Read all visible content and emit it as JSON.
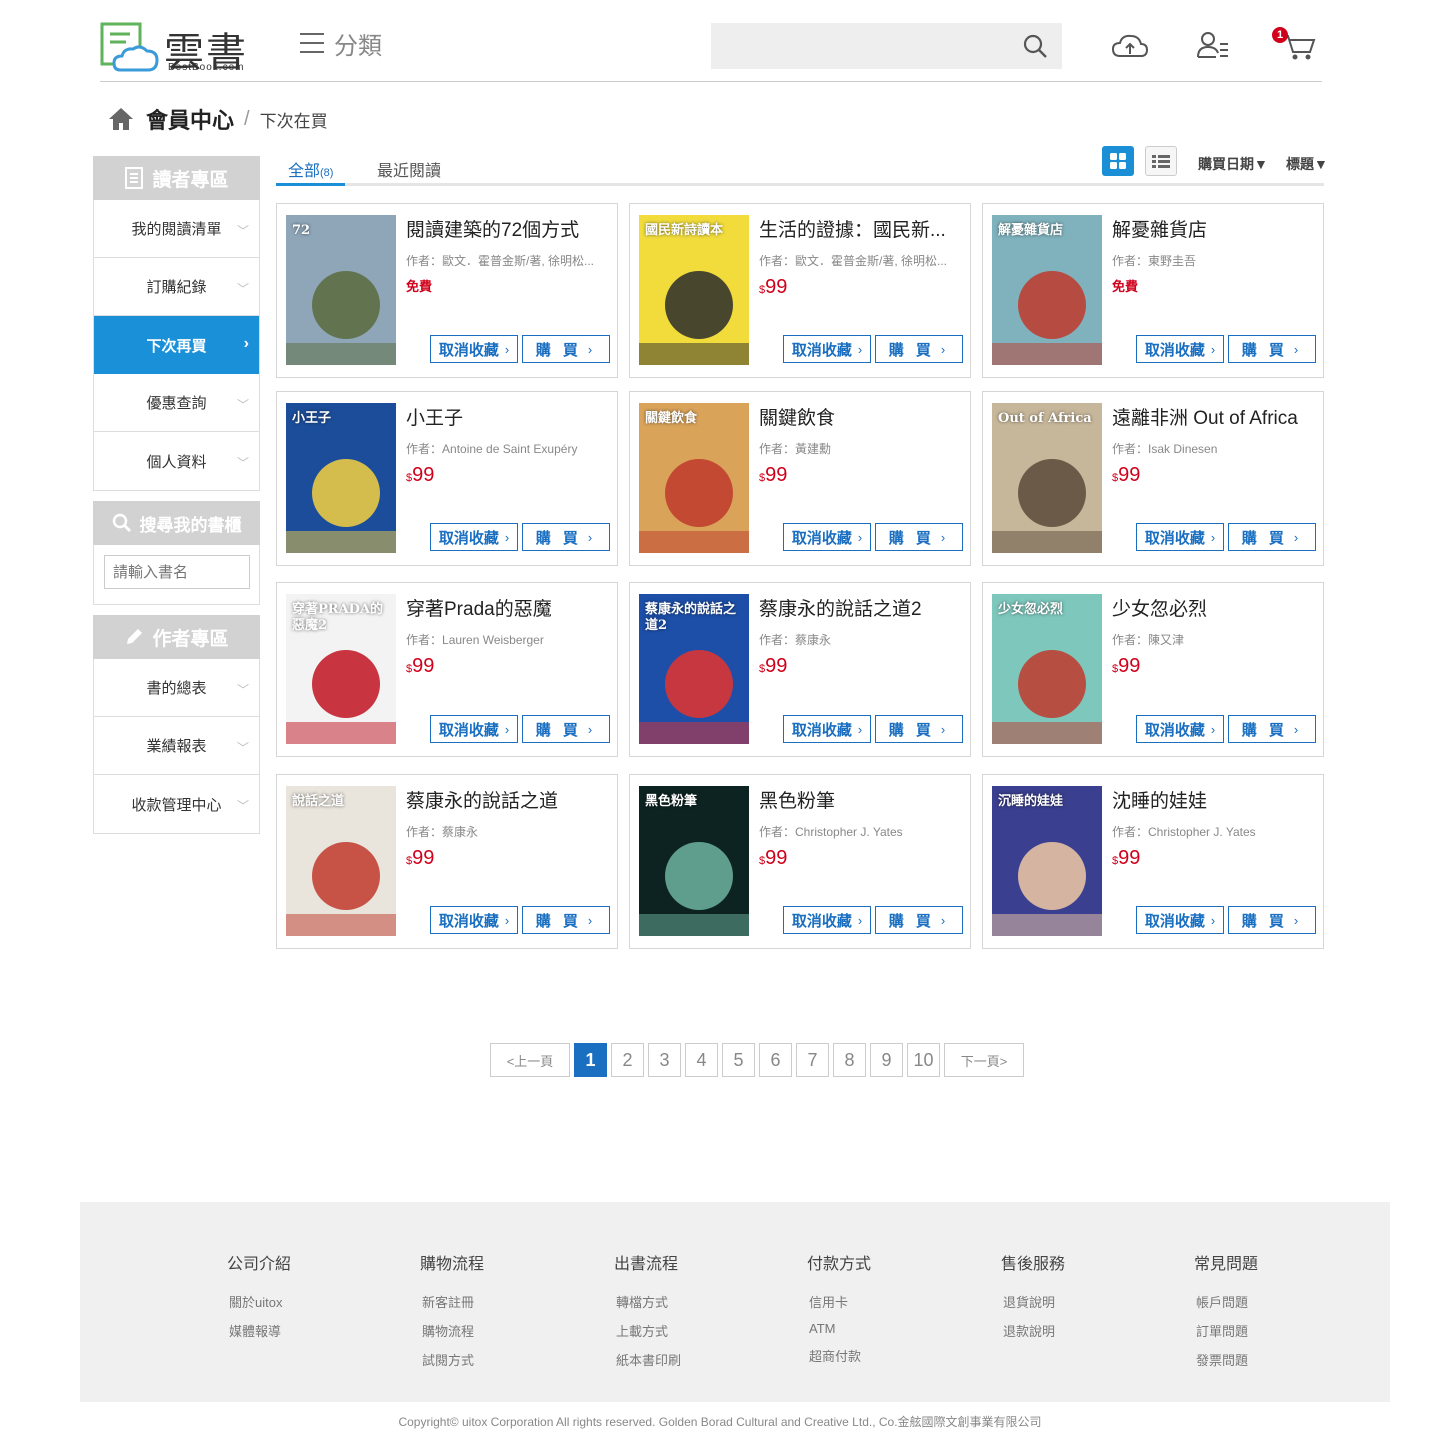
{
  "header": {
    "logo_title": "雲書",
    "logo_sub": "BestBook.com",
    "category_label": "分類",
    "search_placeholder": "",
    "cart_count": "1"
  },
  "breadcrumb": {
    "home": "會員中心",
    "sep": "/",
    "current": "下次在買"
  },
  "sidebar": {
    "reader_title": "讀者專區",
    "reader_items": [
      {
        "label": "我的閱讀清單"
      },
      {
        "label": "訂購紀錄"
      },
      {
        "label": "下次再買",
        "active": true
      },
      {
        "label": "優惠查詢"
      },
      {
        "label": "個人資料"
      }
    ],
    "search_title": "搜尋我的書櫃",
    "search_placeholder": "請輸入書名",
    "author_title": "作者專區",
    "author_items": [
      {
        "label": "書的總表"
      },
      {
        "label": "業績報表"
      },
      {
        "label": "收款管理中心"
      }
    ]
  },
  "tabs": {
    "all_label": "全部",
    "all_count": "(8)",
    "recent_label": "最近閱讀"
  },
  "sort": {
    "by_date": "購買日期▼",
    "by_title": "標題▼"
  },
  "buttons": {
    "unfav": "取消收藏",
    "buy": "購 買"
  },
  "author_prefix": "作者：",
  "currency": "$",
  "books": [
    {
      "title": "閱讀建築的72個方式",
      "author": "歐文．霍普金斯/著, 徐明松...",
      "price": "免費",
      "free": true,
      "cover_bg": "#8fa6b8",
      "cover_accent": "#5a6b3c",
      "cover_text": "72"
    },
    {
      "title": "生活的證據：國民新...",
      "author": "歐文．霍普金斯/著, 徐明松...",
      "price": "99",
      "free": false,
      "cover_bg": "#f1dc3c",
      "cover_accent": "#2b2b2b",
      "cover_text": "國民新詩讀本"
    },
    {
      "title": "解憂雜貨店",
      "author": "東野圭吾",
      "price": "免費",
      "free": true,
      "cover_bg": "#7fb2bd",
      "cover_accent": "#c0392b",
      "cover_text": "解憂雜貨店"
    },
    {
      "title": "小王子",
      "author": "Antoine de Saint Exupéry",
      "price": "99",
      "free": false,
      "cover_bg": "#1c4d9a",
      "cover_accent": "#f4d03f",
      "cover_text": "小王子"
    },
    {
      "title": "關鍵飲食",
      "author": "黃建勳",
      "price": "99",
      "free": false,
      "cover_bg": "#d9a35a",
      "cover_accent": "#c0392b",
      "cover_text": "關鍵飲食"
    },
    {
      "title": "遠離非洲 Out of Africa",
      "author": "Isak Dinesen",
      "price": "99",
      "free": false,
      "cover_bg": "#c7b79a",
      "cover_accent": "#5c4a3a",
      "cover_text": "Out of Africa"
    },
    {
      "title": "穿著Prada的惡魔",
      "author": "Lauren Weisberger",
      "price": "99",
      "free": false,
      "cover_bg": "#f3f3f3",
      "cover_accent": "#c0121f",
      "cover_text": "穿著PRADA的惡魔2"
    },
    {
      "title": "蔡康永的說話之道2",
      "author": "蔡康永",
      "price": "99",
      "free": false,
      "cover_bg": "#1d4fa8",
      "cover_accent": "#e5322d",
      "cover_text": "蔡康永的說話之道2"
    },
    {
      "title": "少女忽必烈",
      "author": "陳又津",
      "price": "99",
      "free": false,
      "cover_bg": "#7ec7bd",
      "cover_accent": "#c0392b",
      "cover_text": "少女忽必烈"
    },
    {
      "title": "蔡康永的說話之道",
      "author": "蔡康永",
      "price": "99",
      "free": false,
      "cover_bg": "#e9e4dc",
      "cover_accent": "#c0392b",
      "cover_text": "說話之道"
    },
    {
      "title": "黑色粉筆",
      "author": "Christopher J. Yates",
      "price": "99",
      "free": false,
      "cover_bg": "#0c2321",
      "cover_accent": "#6fb3a0",
      "cover_text": "黑色粉筆"
    },
    {
      "title": "沈睡的娃娃",
      "author": "Christopher J. Yates",
      "price": "99",
      "free": false,
      "cover_bg": "#3a3f8f",
      "cover_accent": "#f2c9a6",
      "cover_text": "沉睡的娃娃"
    }
  ],
  "pagination": {
    "prev": "<上一頁",
    "next": "下一頁>",
    "pages": [
      "1",
      "2",
      "3",
      "4",
      "5",
      "6",
      "7",
      "8",
      "9",
      "10"
    ],
    "current": "1"
  },
  "footer": {
    "columns": [
      {
        "title": "公司介紹",
        "links": [
          "關於uitox",
          "媒體報導"
        ]
      },
      {
        "title": "購物流程",
        "links": [
          "新客註冊",
          "購物流程",
          "試閱方式"
        ]
      },
      {
        "title": "出書流程",
        "links": [
          "轉檔方式",
          "上載方式",
          "紙本書印刷"
        ]
      },
      {
        "title": "付款方式",
        "links": [
          "信用卡",
          "ATM",
          "超商付款"
        ]
      },
      {
        "title": "售後服務",
        "links": [
          "退貨說明",
          "退款說明"
        ]
      },
      {
        "title": "常見問題",
        "links": [
          "帳戶問題",
          "訂單問題",
          "發票問題"
        ]
      }
    ],
    "copyright": "Copyright© uitox Corporation  All rights reserved.   Golden Borad Cultural and Creative Ltd., Co.金舷國際文創事業有限公司"
  },
  "colors": {
    "accent": "#1a8fd5",
    "link_blue": "#1a6fc1",
    "price_red": "#d0021b",
    "sidebar_head": "#d2d2d2"
  }
}
